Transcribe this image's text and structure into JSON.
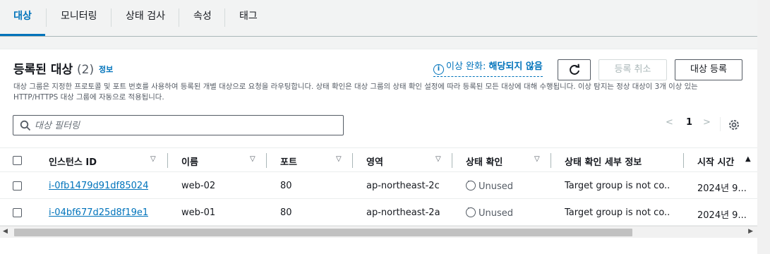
{
  "tabs": [
    {
      "label": "대상",
      "active": true
    },
    {
      "label": "모니터링",
      "active": false
    },
    {
      "label": "상태 검사",
      "active": false
    },
    {
      "label": "속성",
      "active": false
    },
    {
      "label": "태그",
      "active": false
    }
  ],
  "panel": {
    "title": "등록된 대상",
    "count": "(2)",
    "info_link": "정보",
    "description": "대상 그룹은 지정한 프로토콜 및 포트 번호를 사용하여 등록된 개별 대상으로 요청을 라우팅합니다. 상태 확인은 대상 그룹의 상태 확인 설정에 따라 등록된 모든 대상에 대해 수행됩니다. 이상 탐지는 정상 대상이 3개 이상 있는 HTTP/HTTPS 대상 그룹에 자동으로 적용됩니다.",
    "anomaly_label": "이상 완화:",
    "anomaly_value": "해당되지 않음",
    "info_icon": "i",
    "cancel_label": "등록 취소",
    "register_label": "대상 등록"
  },
  "filter": {
    "placeholder": "대상 필터링",
    "value": ""
  },
  "pagination": {
    "prev": "<",
    "page": "1",
    "next": ">"
  },
  "table": {
    "columns": [
      "인스턴스 ID",
      "이름",
      "포트",
      "영역",
      "상태 확인",
      "상태 확인 세부 정보",
      "시작 시간"
    ],
    "rows": [
      {
        "instance_id": "i-0fb1479d91df85024",
        "name": "web-02",
        "port": "80",
        "zone": "ap-northeast-2c",
        "health": "Unused",
        "health_details": "Target group is not co...",
        "launch_time": "2024년 9..."
      },
      {
        "instance_id": "i-04bf677d25d8f19e1",
        "name": "web-01",
        "port": "80",
        "zone": "ap-northeast-2a",
        "health": "Unused",
        "health_details": "Target group is not co...",
        "launch_time": "2024년 9..."
      }
    ]
  },
  "colors": {
    "accent": "#0073bb",
    "text": "#16191f",
    "muted": "#545b64",
    "background": "#f2f3f3"
  }
}
